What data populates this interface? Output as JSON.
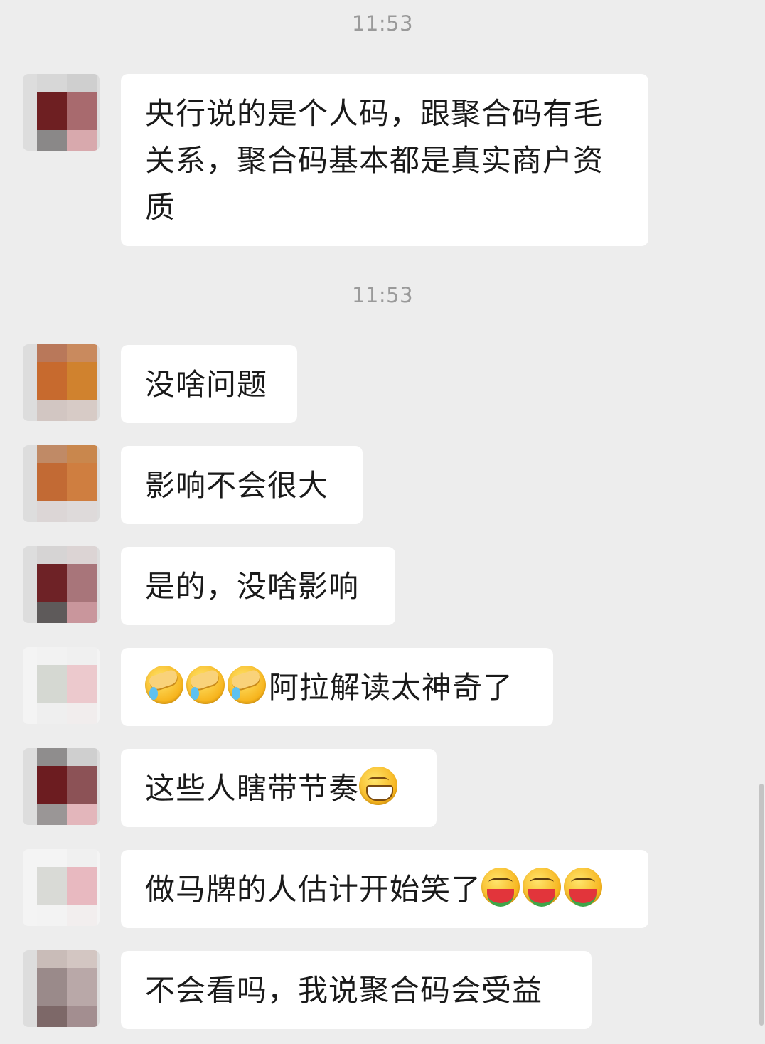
{
  "timestamps": [
    "11:53",
    "11:53"
  ],
  "messages": [
    {
      "text": "央行说的是个人码，跟聚合码有毛关系，聚合码基本都是真实商户资质",
      "emoji_before": [],
      "emoji_after": []
    },
    {
      "text": "没啥问题",
      "emoji_before": [],
      "emoji_after": []
    },
    {
      "text": "影响不会很大",
      "emoji_before": [],
      "emoji_after": []
    },
    {
      "text": "是的，没啥影响",
      "emoji_before": [],
      "emoji_after": []
    },
    {
      "text": "阿拉解读太神奇了",
      "emoji_before": [
        "facepalm-emoji",
        "facepalm-emoji",
        "facepalm-emoji"
      ],
      "emoji_after": []
    },
    {
      "text": "这些人瞎带节奏",
      "emoji_before": [],
      "emoji_after": [
        "grin-emoji"
      ]
    },
    {
      "text": "做马牌的人估计开始笑了",
      "emoji_before": [],
      "emoji_after": [
        "eating-watermelon-emoji",
        "eating-watermelon-emoji",
        "eating-watermelon-emoji"
      ]
    },
    {
      "text": "不会看吗，我说聚合码会受益",
      "emoji_before": [],
      "emoji_after": []
    }
  ],
  "colors": {
    "background": "#ededed",
    "bubble": "#ffffff",
    "text": "#1a1a1a",
    "timestamp": "#9a9a9a"
  }
}
